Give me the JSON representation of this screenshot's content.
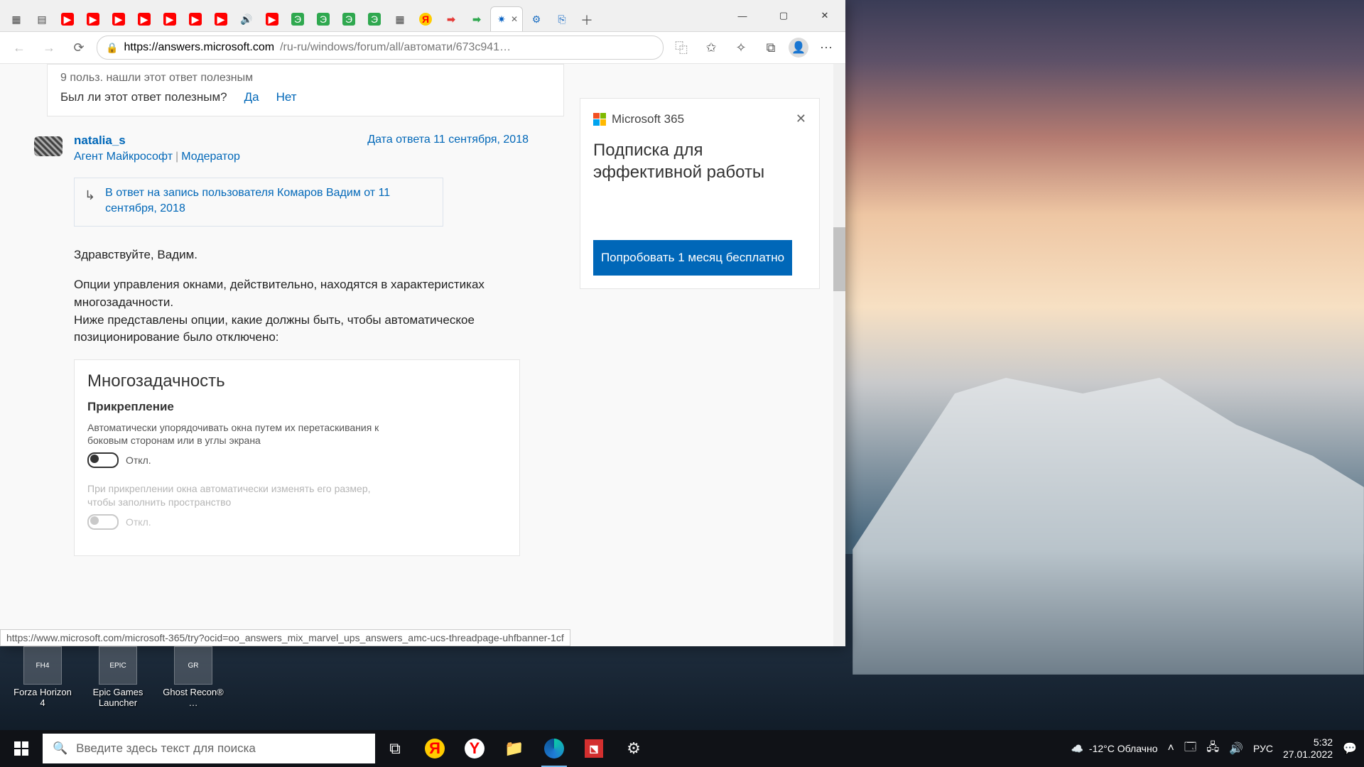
{
  "browser": {
    "url_host": "https://answers.microsoft.com",
    "url_path": "/ru-ru/windows/forum/all/автомати/673c941…",
    "link_status": "https://www.microsoft.com/microsoft-365/try?ocid=oo_answers_mix_marvel_ups_answers_amc-ucs-threadpage-uhfbanner-1cf"
  },
  "helpful": {
    "count_text": "9 польз. нашли этот ответ полезным",
    "question": "Был ли этот ответ полезным?",
    "yes": "Да",
    "no": "Нет"
  },
  "answer": {
    "author": "natalia_s",
    "date": "Дата ответа 11 сентября, 2018",
    "tag1": "Агент Майкрософт",
    "tag2": "Модератор",
    "reply_to": "В ответ на запись пользователя Комаров Вадим от 11 сентября, 2018",
    "greeting": "Здравствуйте, Вадим.",
    "para1": "Опции управления окнами, действительно, находятся в характеристиках многозадачности.",
    "para2": "Ниже представлены опции, какие должны быть, чтобы автоматическое позиционирование было отключено:"
  },
  "settings": {
    "title": "Многозадачность",
    "section": "Прикрепление",
    "opt1_desc": "Автоматически упорядочивать окна путем их перетаскивания к боковым сторонам или в углы экрана",
    "opt1_state": "Откл.",
    "opt2_desc": "При прикреплении окна автоматически изменять его размер, чтобы заполнить пространство",
    "opt2_state": "Откл."
  },
  "promo": {
    "brand": "Microsoft 365",
    "title": "Подписка для эффективной работы",
    "cta": "Попробовать 1 месяц бесплатно"
  },
  "desktop_icons": {
    "forza": "Forza Horizon 4",
    "epic": "Epic Games Launcher",
    "ghost": "Ghost Recon® …"
  },
  "taskbar": {
    "search_placeholder": "Введите здесь текст для поиска",
    "weather_temp": "-12°C Облачно",
    "lang": "РУС",
    "time": "5:32",
    "date": "27.01.2022"
  }
}
